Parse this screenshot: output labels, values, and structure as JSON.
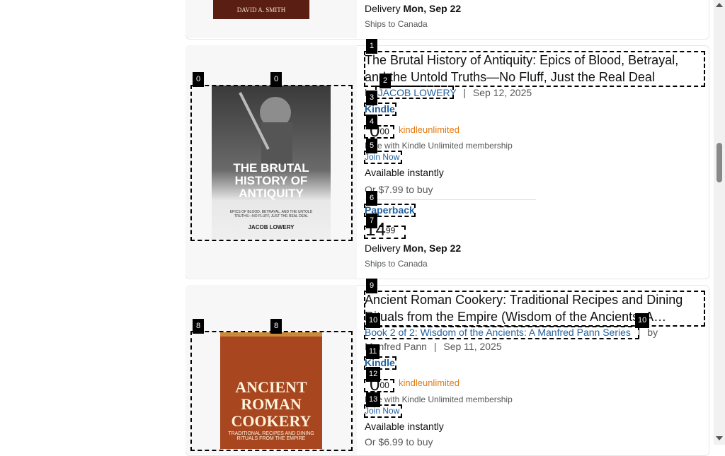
{
  "top_item": {
    "cover_author": "DAVID A. SMITH",
    "delivery_prefix": "Delivery",
    "delivery_date": "Mon, Sep 22",
    "ships_to": "Ships to Canada"
  },
  "item1": {
    "title": "The Brutal History of Antiquity: Epics of Blood, Betrayal, and the Untold Truths—No Fluff, Just the Real Deal",
    "by": "by",
    "author": "JACOB LOWERY",
    "separator": "|",
    "date": "Sep 12, 2025",
    "kindle_label": "Kindle",
    "kindle_price_whole": "0",
    "kindle_price_frac": "00",
    "ku_logo": "kindleunlimited",
    "ku_note": "Free with Kindle Unlimited membership",
    "join_now": "Join Now",
    "available": "Available instantly",
    "or_buy": "Or $7.99 to buy",
    "paperback_label": "Paperback",
    "pb_price_whole": "14",
    "pb_price_frac": "99",
    "delivery_prefix": "Delivery",
    "delivery_date": "Mon, Sep 22",
    "ships_to": "Ships to Canada",
    "cover_title_1": "THE BRUTAL",
    "cover_title_2": "HISTORY OF",
    "cover_title_3": "ANTIQUITY",
    "cover_subtitle": "EPICS OF BLOOD, BETRAYAL, AND THE UNTOLD TRUTHS—NO FLUFF, JUST THE REAL DEAL",
    "cover_author": "JACOB LOWERY"
  },
  "item2": {
    "title": "Ancient Roman Cookery: Traditional Recipes and Dining Rituals from the Empire (Wisdom of the Ancients: A…",
    "series": "Book 2 of 2: Wisdom of the Ancients: A Manfred Pann Series",
    "by": "by",
    "author": "Manfred Pann",
    "separator": "|",
    "date": "Sep 11, 2025",
    "kindle_label": "Kindle",
    "kindle_price_whole": "0",
    "kindle_price_frac": "00",
    "ku_logo": "kindleunlimited",
    "ku_note": "Free with Kindle Unlimited membership",
    "join_now": "Join Now",
    "available": "Available instantly",
    "or_buy": "Or $6.99 to buy",
    "cover_title_1": "ANCIENT",
    "cover_title_2": "ROMAN",
    "cover_title_3": "COOKERY",
    "cover_subtitle": "TRADITIONAL RECIPES AND DINING RITUALS FROM THE EMPIRE"
  },
  "marks": [
    "0",
    "0",
    "1",
    "2",
    "3",
    "4",
    "5",
    "6",
    "7",
    "8",
    "8",
    "9",
    "10",
    "10",
    "11",
    "12",
    "13"
  ]
}
